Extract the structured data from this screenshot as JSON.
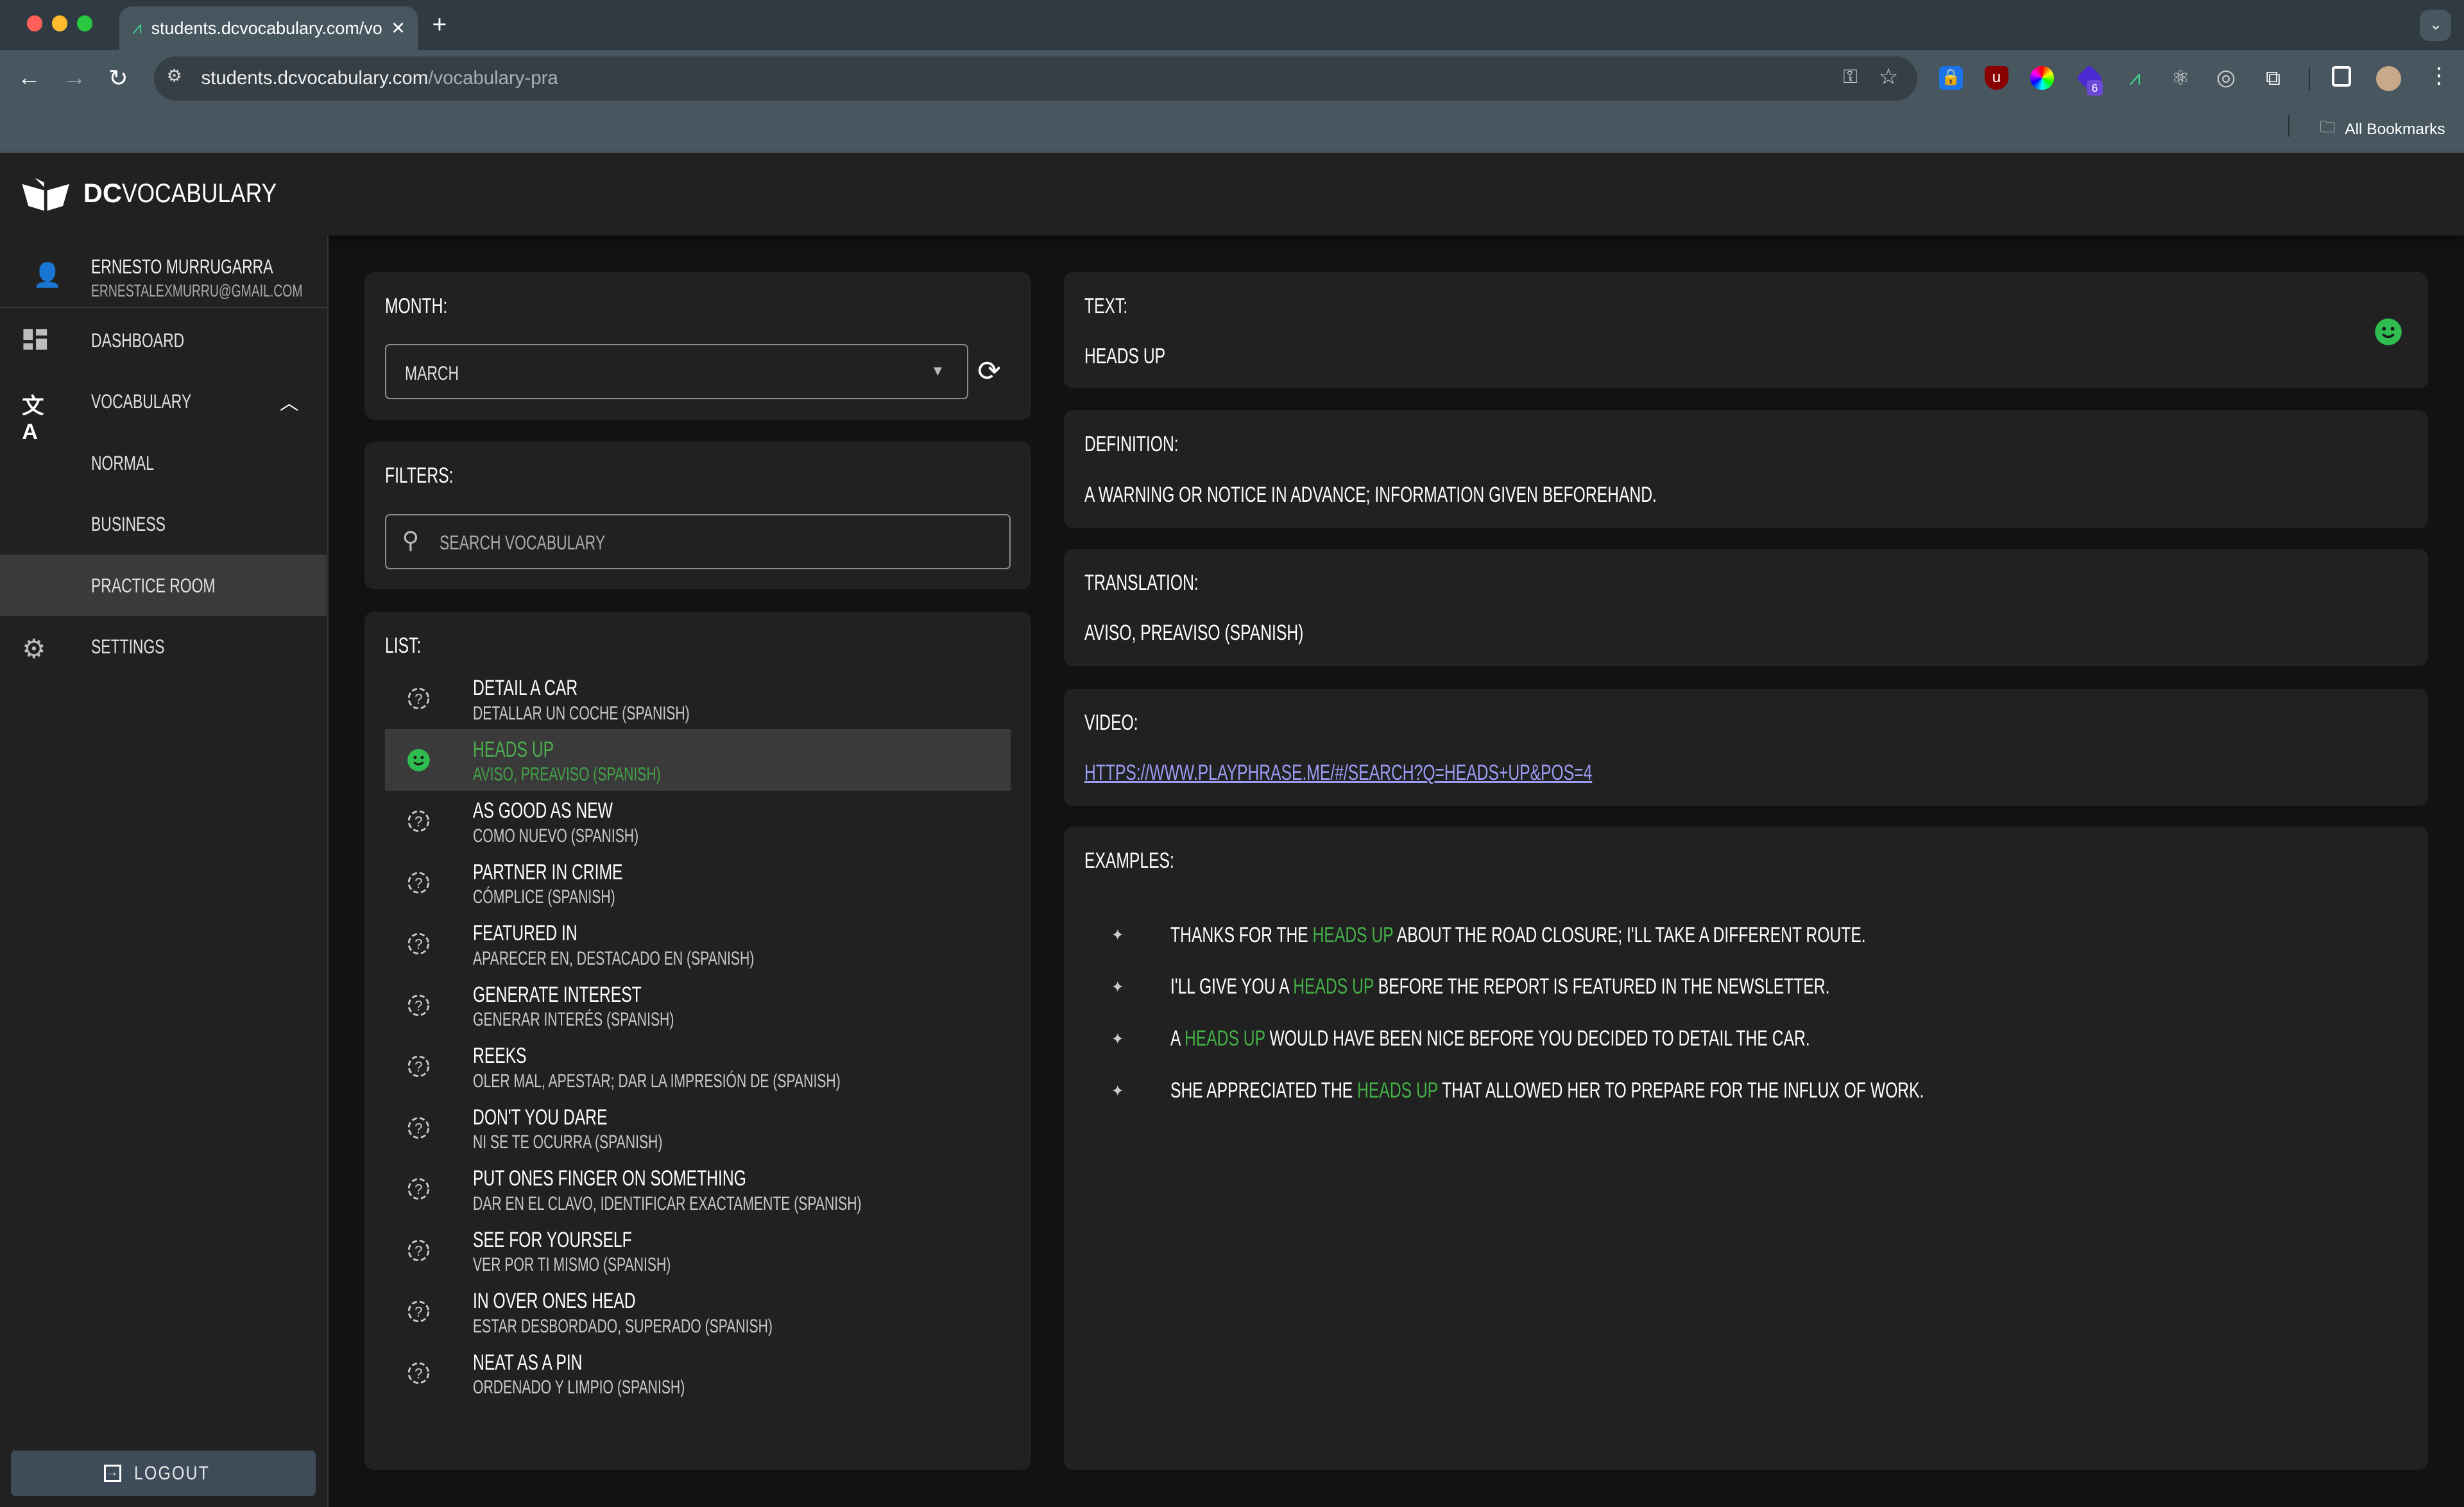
{
  "browser": {
    "tab_title": "students.dcvocabulary.com/vocabulary-practice",
    "url_host": "students.dcvocabulary.com",
    "url_path": "/vocabulary-pra",
    "extension_badge": "6",
    "bookmarks_label": "All Bookmarks"
  },
  "app": {
    "logo_bold": "DC",
    "logo_rest": "VOCABULARY"
  },
  "user": {
    "name": "ERNESTO MURRUGARRA",
    "email": "ERNESTALEXMURRU@GMAIL.COM"
  },
  "sidebar": {
    "items": [
      {
        "label": "DASHBOARD",
        "icon": "dashboard-icon"
      },
      {
        "label": "VOCABULARY",
        "icon": "translate-icon",
        "expanded": true
      },
      {
        "label": "NORMAL"
      },
      {
        "label": "BUSINESS"
      },
      {
        "label": "PRACTICE ROOM",
        "active": true
      },
      {
        "label": "SETTINGS",
        "icon": "gear-icon"
      }
    ],
    "logout": "LOGOUT"
  },
  "month": {
    "label": "MONTH:",
    "value": "MARCH"
  },
  "filters": {
    "label": "FILTERS:",
    "placeholder": "SEARCH VOCABULARY"
  },
  "list": {
    "label": "LIST:",
    "items": [
      {
        "term": "DETAIL A CAR",
        "translation": "DETALLAR UN COCHE (SPANISH)",
        "status": "unknown"
      },
      {
        "term": "HEADS UP",
        "translation": "AVISO, PREAVISO (SPANISH)",
        "status": "learned",
        "selected": true
      },
      {
        "term": "AS GOOD AS NEW",
        "translation": "COMO NUEVO (SPANISH)",
        "status": "unknown"
      },
      {
        "term": "PARTNER IN CRIME",
        "translation": "CÓMPLICE (SPANISH)",
        "status": "unknown"
      },
      {
        "term": "FEATURED IN",
        "translation": "APARECER EN, DESTACADO EN (SPANISH)",
        "status": "unknown"
      },
      {
        "term": "GENERATE INTEREST",
        "translation": "GENERAR INTERÉS (SPANISH)",
        "status": "unknown"
      },
      {
        "term": "REEKS",
        "translation": "OLER MAL, APESTAR; DAR LA IMPRESIÓN DE (SPANISH)",
        "status": "unknown"
      },
      {
        "term": "DON'T YOU DARE",
        "translation": "NI SE TE OCURRA (SPANISH)",
        "status": "unknown"
      },
      {
        "term": "PUT ONES FINGER ON SOMETHING",
        "translation": "DAR EN EL CLAVO, IDENTIFICAR EXACTAMENTE (SPANISH)",
        "status": "unknown"
      },
      {
        "term": "SEE FOR YOURSELF",
        "translation": "VER POR TI MISMO (SPANISH)",
        "status": "unknown"
      },
      {
        "term": "IN OVER ONES HEAD",
        "translation": "ESTAR DESBORDADO, SUPERADO (SPANISH)",
        "status": "unknown"
      },
      {
        "term": "NEAT AS A PIN",
        "translation": "ORDENADO Y LIMPIO (SPANISH)",
        "status": "unknown"
      }
    ]
  },
  "detail": {
    "text_label": "TEXT:",
    "text": "HEADS UP",
    "definition_label": "DEFINITION:",
    "definition": "A WARNING OR NOTICE IN ADVANCE; INFORMATION GIVEN BEFOREHAND.",
    "translation_label": "TRANSLATION:",
    "translation": "AVISO, PREAVISO (SPANISH)",
    "video_label": "VIDEO:",
    "video_url": "HTTPS://WWW.PLAYPHRASE.ME/#/SEARCH?Q=HEADS+UP&POS=4",
    "examples_label": "EXAMPLES:",
    "examples": [
      {
        "before": "THANKS FOR THE ",
        "highlight": "HEADS UP",
        "after": " ABOUT THE ROAD CLOSURE; I'LL TAKE A DIFFERENT ROUTE."
      },
      {
        "before": "I'LL GIVE YOU A ",
        "highlight": "HEADS UP",
        "after": " BEFORE THE REPORT IS FEATURED IN THE NEWSLETTER."
      },
      {
        "before": "A ",
        "highlight": "HEADS UP",
        "after": " WOULD HAVE BEEN NICE BEFORE YOU DECIDED TO DETAIL THE CAR."
      },
      {
        "before": "SHE APPRECIATED THE ",
        "highlight": "HEADS UP",
        "after": " THAT ALLOWED HER TO PREPARE FOR THE INFLUX OF WORK."
      }
    ]
  },
  "colors": {
    "accent_green": "#2ebd4e",
    "highlight_green": "#43b047",
    "link": "#9c9cf5",
    "card": "#212121",
    "background": "#121212"
  }
}
